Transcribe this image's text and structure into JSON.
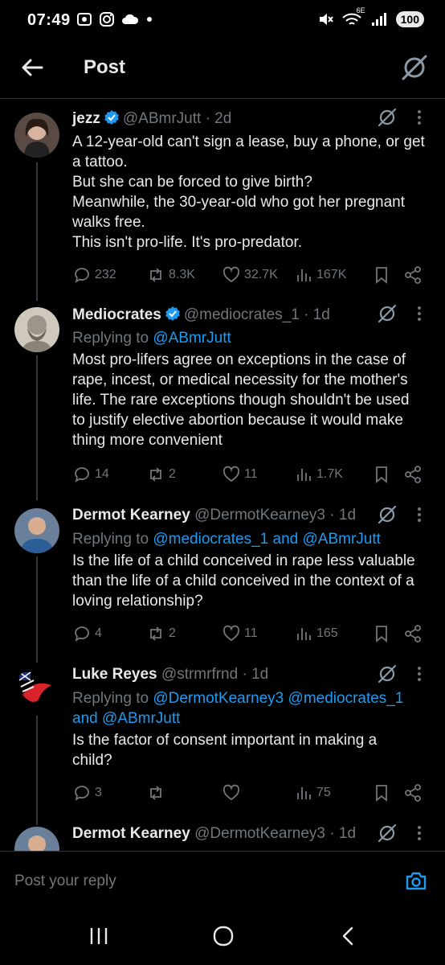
{
  "status_bar": {
    "time": "07:49",
    "battery": "100",
    "network": "6E"
  },
  "header": {
    "title": "Post"
  },
  "tweets": [
    {
      "name": "jezz",
      "verified": true,
      "handle": "@ABmrJutt",
      "time": "· 2d",
      "replying_prefix": "",
      "replying_to": "",
      "lines": [
        "A 12-year-old can't sign a lease, buy a phone, or get",
        "a tattoo.",
        "But she can be forced to give birth?",
        "Meanwhile, the 30-year-old who got her pregnant",
        "walks free.",
        "This isn't pro-life. It's pro-predator."
      ],
      "stats": {
        "replies": "232",
        "reposts": "8.3K",
        "likes": "32.7K",
        "views": "167K"
      }
    },
    {
      "name": "Mediocrates",
      "verified": true,
      "handle": "@mediocrates_1",
      "time": "· 1d",
      "replying_prefix": "Replying to",
      "replying_to": "@ABmrJutt",
      "lines": [
        "Most pro-lifers agree on exceptions in the case of",
        "rape, incest, or medical necessity for the mother's",
        "life. The rare exceptions though shouldn't be used",
        "to justify elective abortion because it would make",
        "thing more convenient"
      ],
      "stats": {
        "replies": "14",
        "reposts": "2",
        "likes": "11",
        "views": "1.7K"
      }
    },
    {
      "name": "Dermot Kearney",
      "verified": false,
      "handle": "@DermotKearney3",
      "time": "· 1d",
      "replying_prefix": "Replying to",
      "replying_to": "@mediocrates_1 and @ABmrJutt",
      "lines": [
        "Is the life of a child conceived in rape less valuable",
        "than the life of a child conceived in the context of a",
        "loving relationship?"
      ],
      "stats": {
        "replies": "4",
        "reposts": "2",
        "likes": "11",
        "views": "165"
      }
    },
    {
      "name": "Luke Reyes",
      "verified": false,
      "handle": "@strmrfrnd",
      "time": "· 1d",
      "replying_prefix": "Replying to",
      "replying_to": "@DermotKearney3 @mediocrates_1",
      "replying_to_2": "and @ABmrJutt",
      "lines": [
        "Is the factor of consent important in making a",
        "child?"
      ],
      "stats": {
        "replies": "3",
        "reposts": "",
        "likes": "",
        "views": "75"
      }
    },
    {
      "name": "Dermot Kearney",
      "verified": false,
      "handle": "@DermotKearney3",
      "time": "· 1d"
    }
  ],
  "reply_bar": {
    "placeholder": "Post your reply"
  },
  "colors": {
    "background": "#000000",
    "text": "#e7e9ea",
    "muted": "#71767b",
    "link": "#1d9bf0",
    "verified": "#1d9bf0"
  },
  "icons": {
    "back": "arrow-left-icon",
    "grok": "grok-icon",
    "more": "more-vertical-icon",
    "reply": "reply-bubble-icon",
    "repost": "repost-icon",
    "like": "heart-icon",
    "views": "views-bars-icon",
    "bookmark": "bookmark-icon",
    "share": "share-icon",
    "camera": "camera-icon"
  }
}
